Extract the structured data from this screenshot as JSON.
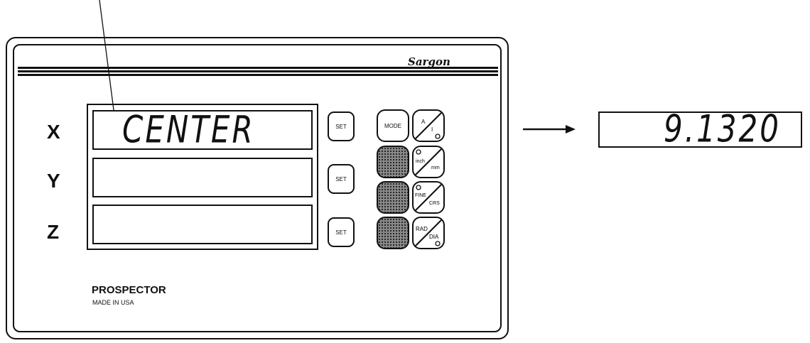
{
  "device": {
    "brand_logo": "Sargon",
    "brand_name": "PROSPECTOR",
    "made_in": "MADE IN USA"
  },
  "axes": [
    {
      "label": "X",
      "readout": "CENTER"
    },
    {
      "label": "Y",
      "readout": ""
    },
    {
      "label": "Z",
      "readout": ""
    }
  ],
  "set_buttons": [
    "SET",
    "SET",
    "SET"
  ],
  "function_keys": [
    {
      "label": "MODE",
      "style": "plain"
    },
    {
      "label": "",
      "style": "dotted"
    },
    {
      "label": "",
      "style": "dotted"
    },
    {
      "label": "",
      "style": "dotted"
    }
  ],
  "toggle_keys": [
    {
      "top": "A",
      "bottom": "I"
    },
    {
      "top": "inch",
      "bottom": "mm"
    },
    {
      "top": "FINE",
      "bottom": "CRS"
    },
    {
      "top": "RAD",
      "bottom": "DIA"
    }
  ],
  "callout": {
    "readout": "9.1320"
  },
  "colors": {
    "ink": "#111111",
    "key_dotted": "#8a8a8a",
    "background": "#ffffff"
  }
}
